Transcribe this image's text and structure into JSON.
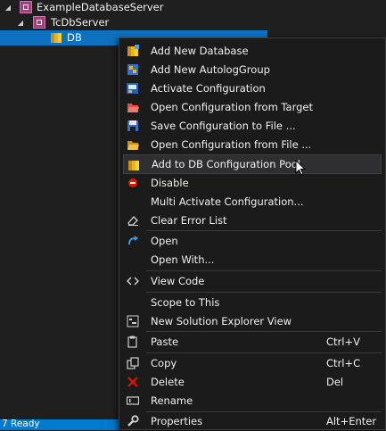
{
  "tree": {
    "items": [
      {
        "label": "ExampleDatabaseServer",
        "icon": "server-icon",
        "expanded": true
      },
      {
        "label": "TcDbServer",
        "icon": "server-icon",
        "expanded": true
      },
      {
        "label": "DB",
        "icon": "database-icon",
        "selected": true
      }
    ]
  },
  "status_bar": {
    "text": "7 Ready"
  },
  "context_menu": {
    "items": [
      {
        "label": "Add New Database",
        "icon": "database-add-icon"
      },
      {
        "label": "Add New AutologGroup",
        "icon": "autolog-group-icon"
      },
      {
        "label": "Activate Configuration",
        "icon": "activate-configuration-icon"
      },
      {
        "label": "Open Configuration from Target",
        "icon": "open-folder-red-icon"
      },
      {
        "label": "Save Configuration to File ...",
        "icon": "save-icon"
      },
      {
        "label": "Open Configuration from File ...",
        "icon": "open-folder-icon"
      },
      {
        "label": "Add to DB Configuration Pool",
        "icon": "db-pool-icon",
        "hovered": true
      },
      {
        "label": "Disable",
        "icon": "disable-icon"
      },
      {
        "label": "Multi Activate Configuration...",
        "icon": ""
      },
      {
        "label": "Clear Error List",
        "icon": "eraser-icon"
      },
      {
        "label": "Open",
        "icon": "open-arrow-icon"
      },
      {
        "label": "Open With...",
        "icon": ""
      },
      {
        "label": "View Code",
        "icon": "code-icon"
      },
      {
        "label": "Scope to This",
        "icon": ""
      },
      {
        "label": "New Solution Explorer View",
        "icon": "solution-explorer-icon"
      },
      {
        "label": "Paste",
        "icon": "paste-icon",
        "shortcut": "Ctrl+V"
      },
      {
        "label": "Copy",
        "icon": "copy-icon",
        "shortcut": "Ctrl+C"
      },
      {
        "label": "Delete",
        "icon": "delete-icon",
        "shortcut": "Del"
      },
      {
        "label": "Rename",
        "icon": "rename-icon"
      },
      {
        "label": "Properties",
        "icon": "wrench-icon",
        "shortcut": "Alt+Enter"
      }
    ]
  },
  "colors": {
    "selection": "#0e70c0",
    "status_bar": "#007acc",
    "menu_background": "#1b1b1c",
    "menu_hover": "#2f2f33",
    "database_yellow": "#e8b520",
    "delete_red": "#e51400",
    "open_blue": "#3d9be9"
  }
}
